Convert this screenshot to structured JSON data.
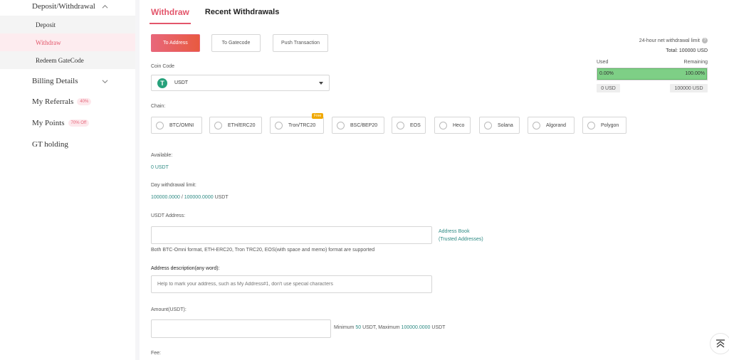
{
  "sidebar": {
    "group_deposit": "Deposit/Withdrawal",
    "sub_items": [
      "Deposit",
      "Withdraw",
      "Redeem GateCode"
    ],
    "billing": "Billing Details",
    "referrals": "My Referrals",
    "referrals_tag": "40%",
    "points": "My Points",
    "points_tag": "70% Off",
    "gt": "GT holding"
  },
  "tabs": [
    "Withdraw",
    "Recent Withdrawals"
  ],
  "methods": [
    "To Address",
    "To Gatecode",
    "Push Transaction"
  ],
  "limit": {
    "title": "24-hour net withdrawal limit",
    "total": "Total: 100000 USD",
    "used_label": "Used",
    "remaining_label": "Remaining",
    "used_pct": "0.00%",
    "remaining_pct": "100.00%",
    "used_amount": "0 USD",
    "remaining_amount": "100000 USD",
    "remaining_fraction": 1.0
  },
  "coin": {
    "label": "Coin Code",
    "value": "USDT",
    "logo": "T"
  },
  "chain": {
    "label": "Chain:",
    "options": [
      "BTC/OMNI",
      "ETH/ERC20",
      "Tron/TRC20",
      "BSC/BEP20",
      "EOS",
      "Heco",
      "Solana",
      "Algorand",
      "Polygon"
    ],
    "free_badge": "Free"
  },
  "available": {
    "label": "Available:",
    "value": "0 USDT"
  },
  "day_limit": {
    "label": "Day withdrawal limit:",
    "used": "100000.0000",
    "sep": " / ",
    "total": "100000.0000",
    "unit": " USDT"
  },
  "address": {
    "label": "USDT Address:",
    "value": "",
    "book_line1": "Address Book",
    "book_line2": "(Trusted Addresses)",
    "note": "Both BTC-Omni format, ETH-ERC20, Tron TRC20, EOS(with space and memo) format are supported"
  },
  "description": {
    "label": "Address description(any word):",
    "placeholder": "Help to mark your address, such as My Address#1, don't use special characters"
  },
  "amount": {
    "label": "Amount(USDT):",
    "value": "",
    "min_prefix": "Minimum ",
    "min_value": "50",
    "min_suffix": " USDT,  Maximum ",
    "max_value": "100000.0000",
    "max_suffix": " USDT"
  },
  "fee": {
    "label": "Fee:"
  },
  "colors": {
    "accent": "#e3566b",
    "teal": "#2d8a83",
    "bar_green": "#7ecf86",
    "usdt": "#26a17b"
  }
}
